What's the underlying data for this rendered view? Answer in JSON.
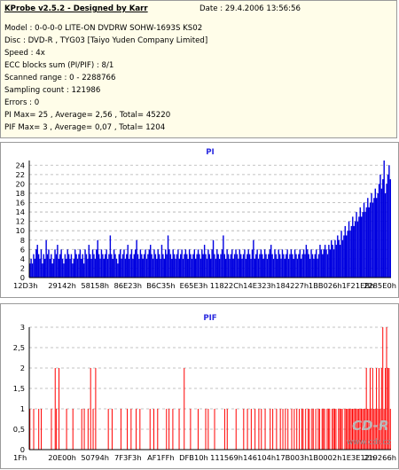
{
  "header": {
    "title": "KProbe v2.5.2 - Designed by Karr",
    "date": "Date : 29.4.2006 13:56:56",
    "lines": [
      "Model : 0-0-0-0 LITE-ON DVDRW SOHW-1693S KS02",
      "Disc : DVD-R , TYG03 [Taiyo Yuden Company Limited]",
      "Speed : 4x",
      "ECC blocks sum (PI/PIF) : 8/1",
      "Scanned range : 0 - 2288766",
      "Sampling count : 121986",
      "Errors : 0",
      "PI Max= 25 , Average= 2,56 , Total= 45220",
      "PIF Max= 3 , Average= 0,07 , Total= 1204"
    ]
  },
  "watermark": {
    "logo": "CD-R",
    "url": "www.cdr.cz"
  },
  "colors": {
    "pi_series": "#0000e0",
    "pif_series": "#ff0000",
    "title": "#2b2be0",
    "info_bg": "#fffde9",
    "grid": "#b0b0b0"
  },
  "chart_data": [
    {
      "type": "area",
      "title": "PI",
      "series": [
        {
          "name": "PI",
          "values": [
            3,
            4,
            3,
            5,
            4,
            6,
            7,
            5,
            4,
            6,
            3,
            5,
            4,
            8,
            5,
            6,
            4,
            5,
            3,
            4,
            6,
            5,
            7,
            4,
            5,
            6,
            4,
            3,
            5,
            4,
            6,
            5,
            4,
            5,
            3,
            4,
            6,
            5,
            4,
            5,
            6,
            4,
            5,
            3,
            6,
            5,
            4,
            7,
            5,
            4,
            6,
            5,
            4,
            6,
            8,
            5,
            4,
            6,
            5,
            4,
            5,
            6,
            4,
            5,
            9,
            5,
            4,
            6,
            5,
            4,
            3,
            5,
            6,
            4,
            5,
            6,
            4,
            5,
            7,
            4,
            5,
            6,
            4,
            5,
            6,
            8,
            5,
            4,
            6,
            5,
            4,
            5,
            6,
            4,
            5,
            6,
            7,
            5,
            4,
            6,
            5,
            4,
            6,
            5,
            4,
            7,
            5,
            4,
            6,
            5,
            9,
            6,
            5,
            4,
            6,
            5,
            4,
            5,
            6,
            4,
            5,
            6,
            4,
            5,
            6,
            5,
            4,
            6,
            5,
            4,
            5,
            6,
            4,
            5,
            6,
            5,
            4,
            6,
            5,
            7,
            5,
            4,
            6,
            5,
            4,
            6,
            8,
            5,
            4,
            6,
            5,
            4,
            5,
            6,
            9,
            5,
            4,
            6,
            5,
            4,
            5,
            6,
            4,
            5,
            6,
            5,
            4,
            6,
            5,
            4,
            5,
            6,
            4,
            5,
            6,
            5,
            4,
            6,
            8,
            4,
            5,
            6,
            4,
            5,
            6,
            5,
            4,
            6,
            5,
            4,
            5,
            6,
            7,
            5,
            4,
            6,
            5,
            4,
            6,
            5,
            4,
            6,
            5,
            4,
            5,
            6,
            4,
            5,
            6,
            5,
            4,
            6,
            5,
            4,
            5,
            6,
            4,
            5,
            6,
            5,
            7,
            6,
            5,
            4,
            6,
            5,
            4,
            5,
            6,
            4,
            5,
            7,
            6,
            5,
            6,
            7,
            6,
            5,
            7,
            6,
            8,
            7,
            6,
            8,
            7,
            9,
            8,
            7,
            10,
            8,
            9,
            11,
            9,
            10,
            12,
            10,
            11,
            13,
            11,
            12,
            14,
            12,
            13,
            15,
            13,
            14,
            16,
            14,
            15,
            17,
            15,
            16,
            18,
            16,
            17,
            19,
            17,
            18,
            20,
            22,
            19,
            21,
            25,
            18,
            20,
            22,
            24,
            21
          ]
        }
      ],
      "x_ticks": [
        "12D3h",
        "29142h",
        "58158h",
        "86E23h",
        "B6C35h",
        "E65E3h",
        "11822Ch",
        "14E323h",
        "184227h",
        "1BB026h",
        "1F21EBh",
        "2285E0h"
      ],
      "y_ticks": [
        0,
        2,
        4,
        6,
        8,
        10,
        12,
        14,
        16,
        18,
        20,
        22,
        24
      ],
      "ylim": [
        0,
        25
      ],
      "grid": true
    },
    {
      "type": "bar",
      "title": "PIF",
      "series": [
        {
          "name": "PIF",
          "values": [
            1,
            0,
            0,
            1,
            0,
            0,
            0,
            1,
            0,
            1,
            0,
            0,
            0,
            0,
            0,
            0,
            0,
            1,
            0,
            0,
            2,
            1,
            0,
            2,
            0,
            0,
            0,
            0,
            0,
            1,
            0,
            0,
            0,
            0,
            1,
            0,
            0,
            0,
            0,
            0,
            0,
            1,
            0,
            1,
            0,
            0,
            1,
            0,
            2,
            0,
            1,
            0,
            2,
            0,
            0,
            0,
            0,
            0,
            0,
            0,
            0,
            0,
            1,
            0,
            0,
            1,
            0,
            0,
            0,
            0,
            0,
            0,
            1,
            0,
            0,
            0,
            0,
            1,
            0,
            0,
            1,
            0,
            0,
            0,
            1,
            0,
            0,
            1,
            0,
            0,
            0,
            0,
            0,
            0,
            0,
            1,
            0,
            0,
            1,
            0,
            0,
            1,
            0,
            0,
            0,
            0,
            0,
            0,
            1,
            0,
            1,
            0,
            0,
            1,
            0,
            0,
            0,
            0,
            1,
            0,
            0,
            0,
            2,
            0,
            0,
            0,
            0,
            1,
            0,
            0,
            0,
            0,
            0,
            1,
            0,
            0,
            0,
            0,
            0,
            1,
            0,
            1,
            0,
            0,
            0,
            0,
            1,
            0,
            0,
            0,
            0,
            0,
            0,
            0,
            1,
            0,
            1,
            0,
            0,
            0,
            0,
            0,
            0,
            1,
            0,
            0,
            0,
            0,
            0,
            1,
            0,
            0,
            1,
            0,
            0,
            1,
            0,
            0,
            1,
            0,
            0,
            1,
            0,
            1,
            0,
            0,
            1,
            0,
            0,
            0,
            1,
            0,
            1,
            0,
            0,
            1,
            0,
            0,
            1,
            0,
            1,
            0,
            1,
            0,
            1,
            0,
            0,
            1,
            0,
            1,
            0,
            1,
            0,
            1,
            0,
            1,
            1,
            0,
            1,
            0,
            1,
            1,
            0,
            1,
            1,
            0,
            1,
            0,
            1,
            1,
            0,
            1,
            1,
            1,
            0,
            1,
            1,
            1,
            0,
            1,
            1,
            1,
            1,
            0,
            1,
            1,
            1,
            1,
            0,
            1,
            1,
            1,
            1,
            1,
            1,
            1,
            1,
            1,
            1,
            1,
            1,
            1,
            1,
            1,
            1,
            1,
            2,
            1,
            1,
            2,
            1,
            2,
            1,
            1,
            2,
            1,
            2,
            1,
            2,
            3,
            1,
            2,
            3,
            2,
            2,
            1
          ]
        }
      ],
      "x_ticks": [
        "1Fh",
        "20E00h",
        "50794h",
        "7F3F3h",
        "AF1FFh",
        "DFB10h",
        "111569h",
        "146104h",
        "17B003h",
        "1B0002h",
        "1E3E12h",
        "219266h"
      ],
      "y_ticks": [
        0,
        0.5,
        1,
        1.5,
        2,
        2.5,
        3
      ],
      "y_tick_labels": [
        "0",
        "0,5",
        "1",
        "1,5",
        "2",
        "2,5",
        "3"
      ],
      "ylim": [
        0,
        3
      ],
      "grid": true
    }
  ]
}
